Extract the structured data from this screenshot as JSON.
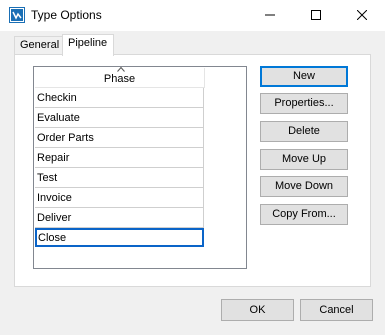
{
  "window": {
    "title": "Type Options"
  },
  "tabs": [
    {
      "label": "General"
    },
    {
      "label": "Pipeline"
    }
  ],
  "list": {
    "column_header": "Phase",
    "items": [
      "Checkin",
      "Evaluate",
      "Order Parts",
      "Repair",
      "Test",
      "Invoice",
      "Deliver",
      "Close"
    ],
    "selected": "Close"
  },
  "actions": {
    "new": "New",
    "properties": "Properties...",
    "delete": "Delete",
    "move_up": "Move Up",
    "move_down": "Move Down",
    "copy_from": "Copy From..."
  },
  "footer": {
    "ok": "OK",
    "cancel": "Cancel"
  },
  "colors": {
    "selection": "#0a64c8",
    "default_button_border": "#0078d7",
    "app_icon": "#1a6fb5"
  },
  "icons": {
    "app": "app-icon",
    "minimize": "minimize-icon",
    "maximize": "maximize-icon",
    "close": "close-icon",
    "sort": "sort-ascending-icon"
  }
}
